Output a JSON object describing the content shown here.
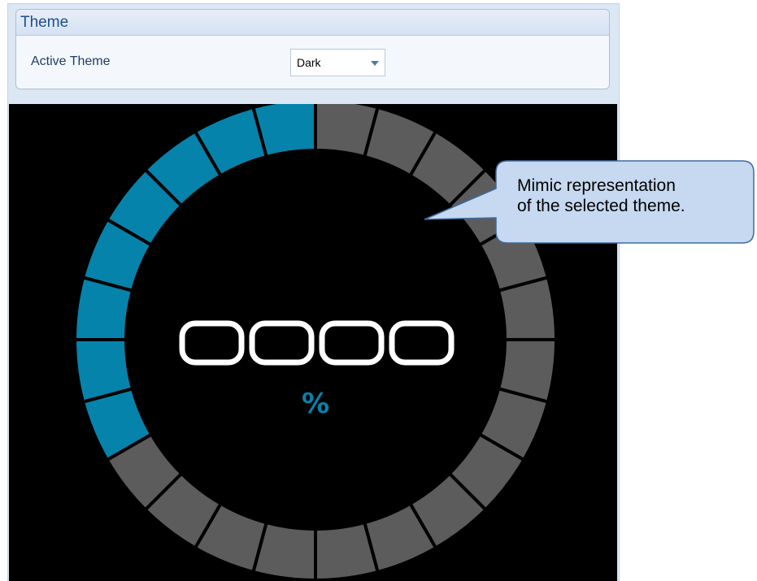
{
  "group": {
    "title": "Theme"
  },
  "active_theme": {
    "label": "Active Theme",
    "selected": "Dark"
  },
  "mimic": {
    "digits": "0000",
    "unit": "%",
    "segments_total": 24,
    "segments_active": 8,
    "active_color": "#0583ab",
    "inactive_color": "#5c5c5c",
    "background_color": "#000000",
    "digit_color": "#ffffff"
  },
  "callout": {
    "line1": "Mimic representation",
    "line2": "of the selected theme."
  }
}
